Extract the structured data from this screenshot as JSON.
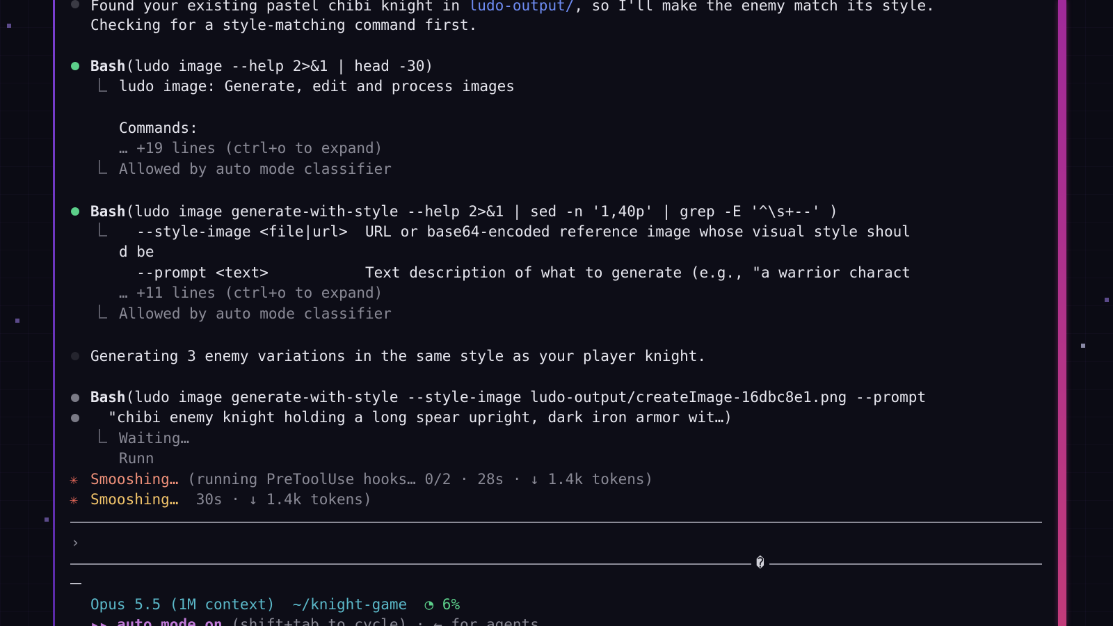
{
  "transcript": {
    "intro": {
      "line1_pre": "Found your existing pastel chibi knight in ",
      "line1_link": "ludo-output/",
      "line1_post": ", so I'll make the enemy match its style.",
      "line2": "Checking for a style-matching command first."
    },
    "bash1": {
      "tool": "Bash",
      "command": "(ludo image --help 2>&1 | head -30)",
      "out1": "ludo image: Generate, edit and process images",
      "out2": "Commands:",
      "more": "… +19 lines (ctrl+o to expand)",
      "allowed": "Allowed by auto mode classifier"
    },
    "bash2": {
      "tool": "Bash",
      "command": "(ludo image generate-with-style --help 2>&1 | sed -n '1,40p' | grep -E '^\\s+--' )",
      "out1": "  --style-image <file|url>  URL or base64-encoded reference image whose visual style shoul",
      "out2": "d be",
      "out3": "  --prompt <text>           Text description of what to generate (e.g., \"a warrior charact",
      "more": "… +11 lines (ctrl+o to expand)",
      "allowed": "Allowed by auto mode classifier"
    },
    "message": "Generating 3 enemy variations in the same style as your player knight.",
    "bash3": {
      "tool": "Bash",
      "command1": "(ludo image generate-with-style --style-image ludo-output/createImage-16dbc8e1.png --prompt",
      "command2": "  \"chibi enemy knight holding a long spear upright, dark iron armor wit…)",
      "waiting": "Waiting…",
      "running": "Runn"
    },
    "status1": {
      "glyph": "✳",
      "verb": "Smooshing…",
      "detail": " (running PreToolUse hooks… 0/2 · 28s · ↓ 1.4k tokens)"
    },
    "status2": {
      "glyph": "✳",
      "verb": "Smooshing…",
      "detail": "  30s · ↓ 1.4k tokens)"
    }
  },
  "input": {
    "caret": "›",
    "divider_glyph": "�"
  },
  "footer": {
    "model": "Opus 5.5 (1M context)",
    "dir": "~/knight-game",
    "context_icon": "◔",
    "context_pct": "6%",
    "mode_chevrons": "▸▸",
    "mode_label": "auto mode on",
    "mode_hint": "(shift+tab to cycle) · ← for agents"
  },
  "colors": {
    "accent_purple": "#7a3fd0",
    "accent_pink": "#c23b7a",
    "success_green": "#5ccf8a",
    "pending_gray": "#7a7a86",
    "link_blue": "#6f8df5"
  }
}
